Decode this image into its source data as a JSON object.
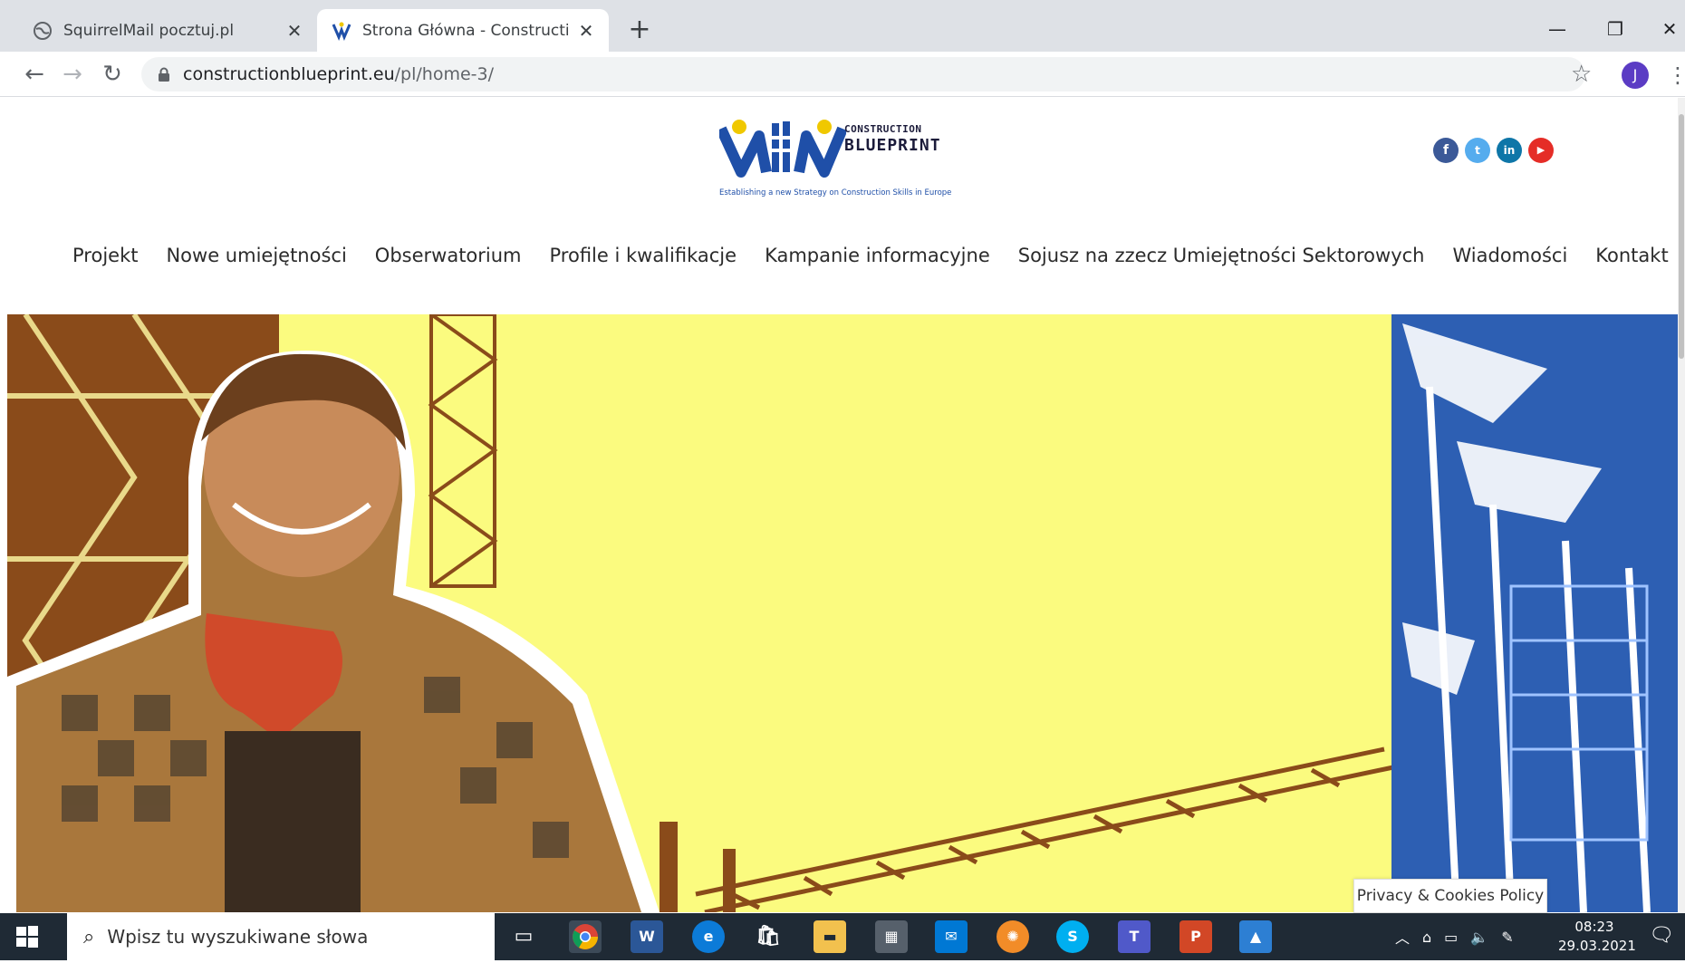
{
  "browser": {
    "tabs": [
      {
        "title": "SquirrelMail pocztuj.pl",
        "favicon": "globe-icon",
        "active": false
      },
      {
        "title": "Strona Główna - Construction Bl",
        "favicon": "construction-blueprint-icon",
        "active": true
      }
    ],
    "address": {
      "host": "constructionblueprint.eu",
      "path": "/pl/home-3/"
    },
    "profile_initial": "J"
  },
  "site": {
    "logo": {
      "line1": "CONSTRUCTION",
      "line2": "BLUEPRINT",
      "tagline": "Establishing a new Strategy on Construction Skills in Europe"
    },
    "social": [
      "f",
      "t",
      "in",
      "▶"
    ],
    "nav": [
      "Projekt",
      "Nowe umiejętności",
      "Obserwatorium",
      "Profile i kwalifikacje",
      "Kampanie informacyjne",
      "Sojusz na zzecz Umiejętności Sektorowych",
      "Wiadomości",
      "Kontakt"
    ],
    "privacy_button": "Privacy & Cookies Policy"
  },
  "taskbar": {
    "search_placeholder": "Wpisz tu wyszukiwane słowa",
    "time": "08:23",
    "date": "29.03.2021",
    "word_label": "W",
    "skype_label": "S",
    "teams_label": "T",
    "ppt_label": "P"
  },
  "colors": {
    "hero_yellow": "#fbfb7f",
    "brand_blue": "#1f4fa8",
    "taskbar": "#1f2a35"
  }
}
